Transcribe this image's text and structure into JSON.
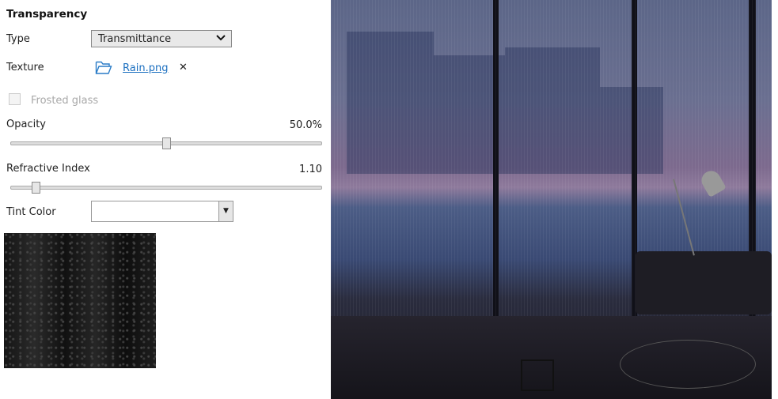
{
  "section_title": "Transparency",
  "type": {
    "label": "Type",
    "value": "Transmittance",
    "icon": "chevron-down-icon"
  },
  "texture": {
    "label": "Texture",
    "file": "Rain.png",
    "folder_icon": "folder-icon",
    "clear_icon": "close-icon",
    "clear_glyph": "✕"
  },
  "frosted_glass": {
    "label": "Frosted glass",
    "checked": false,
    "enabled": false
  },
  "opacity": {
    "label": "Opacity",
    "value_text": "50.0%",
    "value_percent": 50
  },
  "refractive_index": {
    "label": "Refractive Index",
    "value_text": "1.10",
    "fraction": 0.07
  },
  "tint_color": {
    "label": "Tint Color",
    "value": "#ffffff",
    "dropdown_glyph": "▼"
  },
  "colors": {
    "link": "#1b6fc0",
    "disabled_text": "#a8a8a8"
  }
}
